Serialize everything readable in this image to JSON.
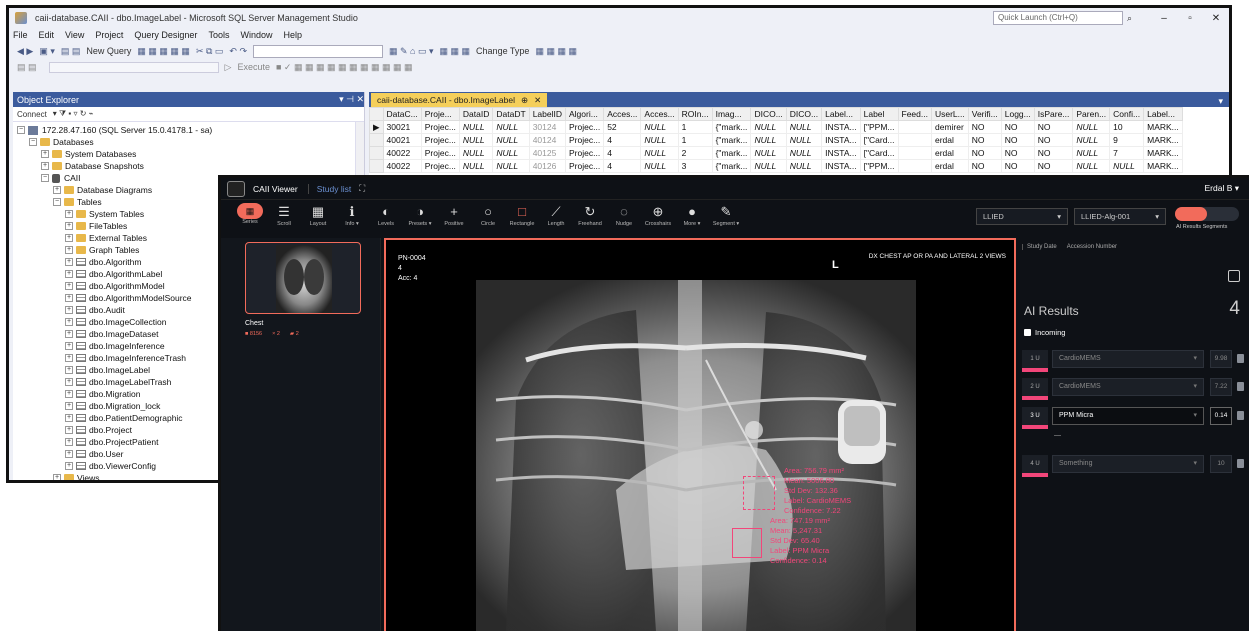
{
  "ssms": {
    "title": "caii-database.CAII - dbo.ImageLabel - Microsoft SQL Server Management Studio",
    "quick_launch": "Quick Launch (Ctrl+Q)",
    "menu": [
      "File",
      "Edit",
      "View",
      "Project",
      "Query Designer",
      "Tools",
      "Window",
      "Help"
    ],
    "toolbar": {
      "new_query": "New Query",
      "change_type": "Change Type",
      "execute": "Execute"
    },
    "object_explorer": {
      "title": "Object Explorer",
      "connect": "Connect",
      "server": "172.28.47.160 (SQL Server 15.0.4178.1 - sa)",
      "databases": "Databases",
      "system_databases": "System Databases",
      "database_snapshots": "Database Snapshots",
      "db": "CAII",
      "database_diagrams": "Database Diagrams",
      "tables": "Tables",
      "folders": [
        "System Tables",
        "FileTables",
        "External Tables",
        "Graph Tables"
      ],
      "table_list": [
        "dbo.Algorithm",
        "dbo.AlgorithmLabel",
        "dbo.AlgorithmModel",
        "dbo.AlgorithmModelSource",
        "dbo.Audit",
        "dbo.ImageCollection",
        "dbo.ImageDataset",
        "dbo.ImageInference",
        "dbo.ImageInferenceTrash",
        "dbo.ImageLabel",
        "dbo.ImageLabelTrash",
        "dbo.Migration",
        "dbo.Migration_lock",
        "dbo.PatientDemographic",
        "dbo.Project",
        "dbo.ProjectPatient",
        "dbo.User",
        "dbo.ViewerConfig"
      ],
      "views": "Views"
    },
    "query_tab": "caii-database.CAII - dbo.ImageLabel",
    "grid": {
      "columns": [
        "DataC...",
        "Proje...",
        "DataID",
        "DataDT",
        "LabelID",
        "Algori...",
        "Acces...",
        "Acces...",
        "ROIn...",
        "Imag...",
        "DICO...",
        "DICO...",
        "Label...",
        "Label",
        "Feed...",
        "UserL...",
        "Verifi...",
        "Logg...",
        "IsPare...",
        "Paren...",
        "Confi...",
        "Label..."
      ],
      "rows": [
        [
          "30021",
          "Projec...",
          "NULL",
          "NULL",
          "30124",
          "Projec...",
          "52",
          "NULL",
          "1",
          "{\"mark...",
          "NULL",
          "NULL",
          "INSTA...",
          "[\"PPM...",
          "",
          "demirer",
          "NO",
          "NO",
          "NO",
          "NULL",
          "10",
          "MARK..."
        ],
        [
          "40021",
          "Projec...",
          "NULL",
          "NULL",
          "40124",
          "Projec...",
          "4",
          "NULL",
          "1",
          "{\"mark...",
          "NULL",
          "NULL",
          "INSTA...",
          "[\"Card...",
          "",
          "erdal",
          "NO",
          "NO",
          "NO",
          "NULL",
          "9",
          "MARK..."
        ],
        [
          "40022",
          "Projec...",
          "NULL",
          "NULL",
          "40125",
          "Projec...",
          "4",
          "NULL",
          "2",
          "{\"mark...",
          "NULL",
          "NULL",
          "INSTA...",
          "[\"Card...",
          "",
          "erdal",
          "NO",
          "NO",
          "NO",
          "NULL",
          "7",
          "MARK..."
        ],
        [
          "40022",
          "Projec...",
          "NULL",
          "NULL",
          "40126",
          "Projec...",
          "4",
          "NULL",
          "3",
          "{\"mark...",
          "NULL",
          "NULL",
          "INSTA...",
          "[\"PPM...",
          "",
          "erdal",
          "NO",
          "NO",
          "NO",
          "NULL",
          "NULL",
          "MARK..."
        ]
      ]
    }
  },
  "viewer": {
    "title": "CAII Viewer",
    "study_list": "Study list",
    "user": "Erdal B",
    "tools": [
      "Series",
      "Scroll",
      "Layout",
      "Info",
      "Levels",
      "Presets",
      "Positive",
      "Circle",
      "Rectangle",
      "Length",
      "Freehand",
      "Nudge",
      "Crosshairs",
      "More",
      "Segment"
    ],
    "selector1": "LLIED",
    "selector2": "LLIED-Alg-001",
    "segment_labels": "AI Results  Segments",
    "thumbnail": {
      "label": "Chest",
      "count1": "8156",
      "count2": "2",
      "count3": "2"
    },
    "overlay": {
      "patient": "PN-0004",
      "line2": "4",
      "acc": "Acc: 4",
      "description": "DX CHEST AP OR PA AND LATERAL 2 VIEWS",
      "marker": "L"
    },
    "roi1": [
      "Area: 756.79 mm²",
      "Mean: 5006.80",
      "Std Dev: 132.36",
      "Label: CardioMEMS",
      "Confidence: 7.22"
    ],
    "roi2": [
      "Area: 747.19 mm²",
      "Mean: 5,247.31",
      "Std Dev: 65.40",
      "Label: PPM Micra",
      "Confidence: 0.14"
    ],
    "ai_panel": {
      "col1": "Study Date",
      "col2": "Accession Number",
      "title": "AI Results",
      "count": "4",
      "incoming": "Incoming",
      "rows": [
        {
          "idx": "1 U",
          "label": "CardioMEMS",
          "conf": "9.98"
        },
        {
          "idx": "2 U",
          "label": "CardioMEMS",
          "conf": "7.22"
        },
        {
          "idx": "3 U",
          "label": "PPM Micra",
          "conf": "0.14"
        },
        {
          "idx": "4 U",
          "label": "Something",
          "conf": "10"
        }
      ],
      "row3_sub": "—"
    },
    "colors": {
      "accent": "#f26b5b",
      "roi": "#f2467a"
    }
  }
}
